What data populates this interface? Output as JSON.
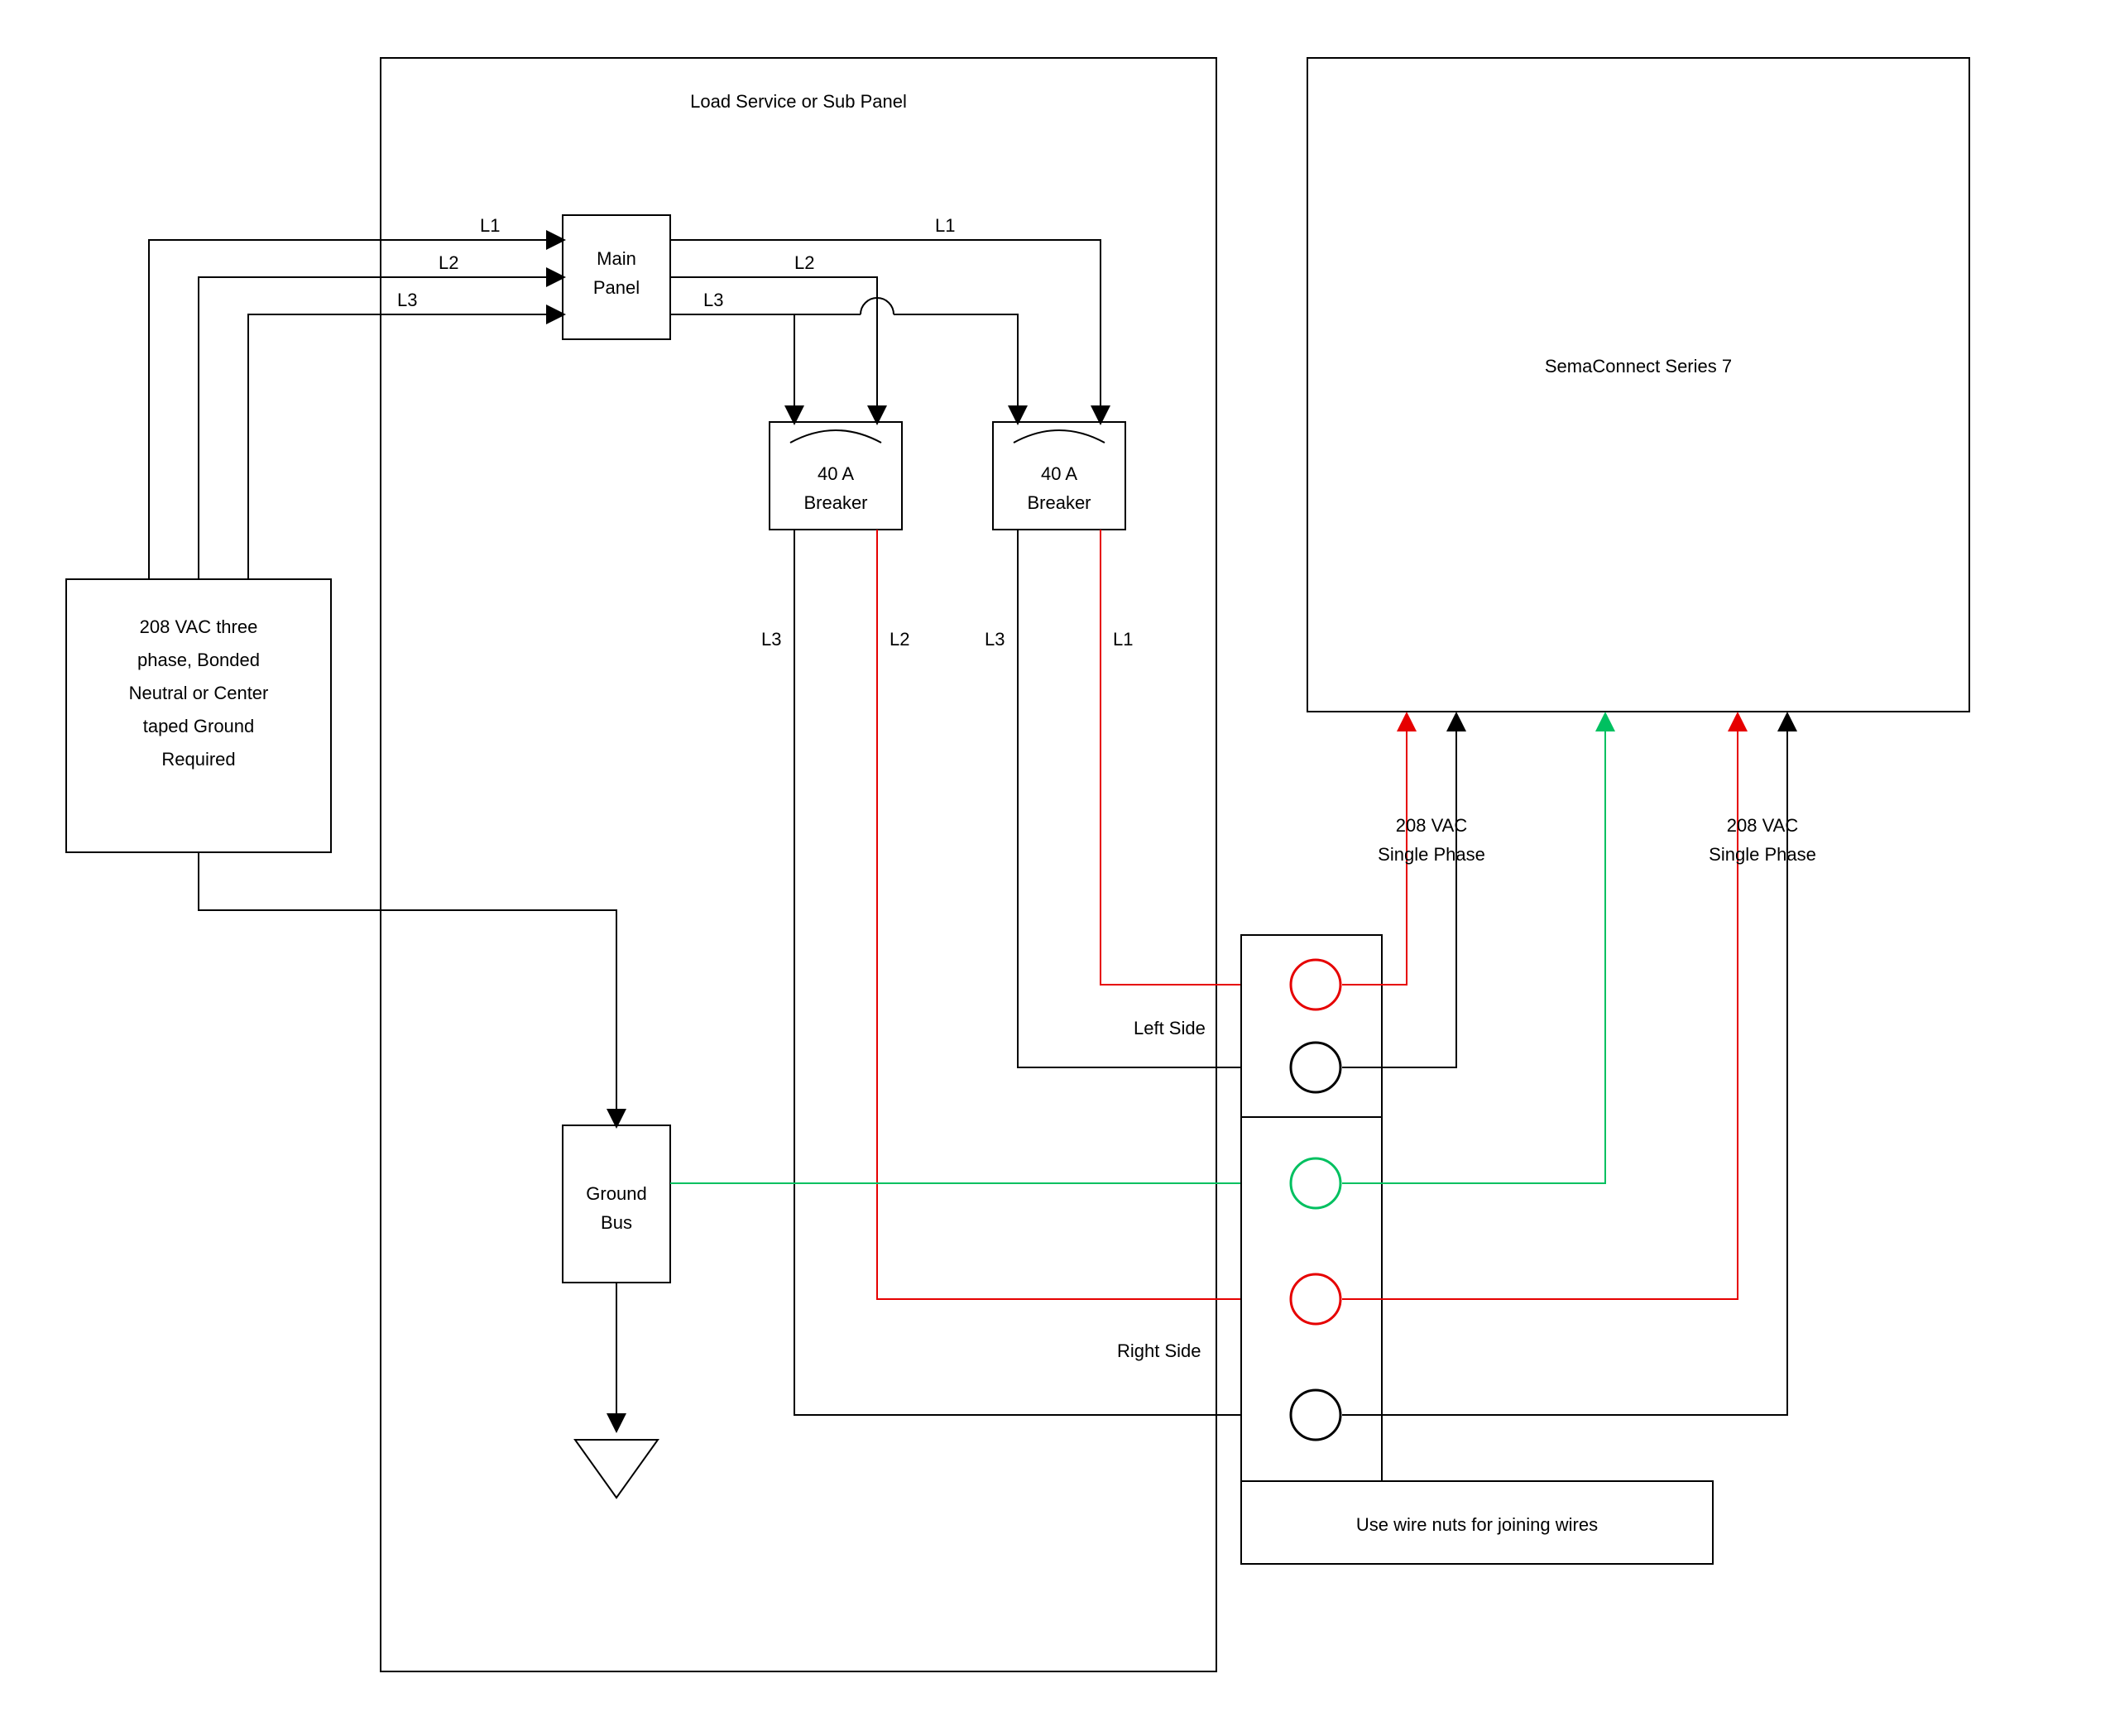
{
  "title": "Load Service or Sub Panel",
  "source_box": "208 VAC three phase, Bonded Neutral or Center taped Ground Required",
  "main_panel": "Main Panel",
  "breaker1": "40 A Breaker",
  "breaker2": "40 A Breaker",
  "ground_bus": "Ground Bus",
  "ground_bus_l1": "Ground",
  "ground_bus_l2": "Bus",
  "sema": "SemaConnect Series 7",
  "left_side": "Left Side",
  "right_side": "Right Side",
  "wire_nuts": "Use wire nuts for joining wires",
  "phase_left": "208 VAC Single Phase",
  "phase_left_l1": "208 VAC",
  "phase_left_l2": "Single Phase",
  "phase_right": "208 VAC Single Phase",
  "phase_right_l1": "208 VAC",
  "phase_right_l2": "Single Phase",
  "L1": "L1",
  "L2": "L2",
  "L3": "L3"
}
